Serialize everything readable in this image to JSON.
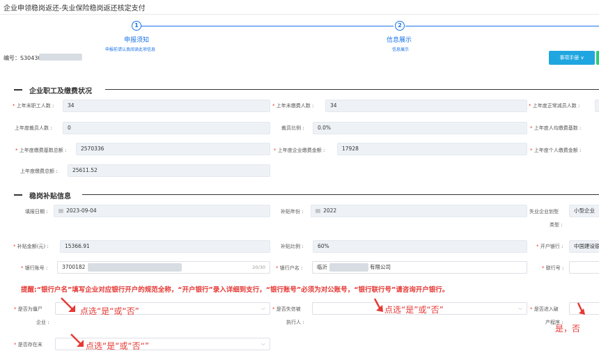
{
  "page": {
    "title": "企业申领稳岗返还-失业保险稳岗返还核定支付"
  },
  "steps": [
    {
      "num": "1",
      "title": "申报须知",
      "sub": "申报前请认真阅读此项信息"
    },
    {
      "num": "2",
      "title": "信息展示",
      "sub": "信息展示"
    }
  ],
  "header": {
    "serial_label": "编号：S3043090",
    "manual_button": "事项手册 ∨"
  },
  "section1": {
    "title": "企业职工及缴费状况",
    "fields": {
      "last_year_end_staff": {
        "label": "上年末职工人数",
        "value": "34"
      },
      "last_year_end_paid": {
        "label": "上年末缴费人数",
        "value": "34"
      },
      "last_year_reduced": {
        "label": "上年度正常减员人数"
      },
      "last_year_laid_off": {
        "label": "上年度裁员人数",
        "value": "0"
      },
      "layoff_ratio": {
        "label": "裁员比例",
        "value": "0.0%"
      },
      "avg_base": {
        "label": "上年度人均缴费基数"
      },
      "total_base": {
        "label": "上年度缴费基数总额",
        "value": "2570336"
      },
      "enterprise_amount": {
        "label": "上年度企业缴费金额",
        "value": "17928"
      },
      "personal_amount": {
        "label": "上年度个人缴费金额"
      },
      "total_paid": {
        "label": "上年度缴费总额",
        "value": "25611.52"
      }
    }
  },
  "section2": {
    "title": "稳岗补贴信息",
    "fields": {
      "fill_date": {
        "label": "填报日期",
        "value": "2023-09-04"
      },
      "subsidy_year": {
        "label": "补贴年份",
        "value": "2022"
      },
      "enterprise_type": {
        "label": "失业企业划型",
        "label2": "类型",
        "value": "小型企业"
      },
      "subsidy_amount": {
        "label": "补贴金额(元)",
        "value": "15366.91"
      },
      "subsidy_ratio": {
        "label": "补贴比例",
        "value": "60%"
      },
      "bank": {
        "label": "开户银行",
        "value": "中国建设银"
      },
      "account_no": {
        "label": "银行账号",
        "value": "3700182",
        "counter": "20/30"
      },
      "account_name": {
        "label": "银行户名",
        "value_prefix": "临沂",
        "value_suffix": "有限公司"
      },
      "bank_link_no": {
        "label": "联行号"
      },
      "zombie": {
        "label": "是否为僵尸",
        "label2": "企业"
      },
      "dishonest": {
        "label": "是否失信被",
        "label2": "执行人"
      },
      "bankruptcy": {
        "label": "是否进入破",
        "label2": "产程序"
      },
      "exists": {
        "label": "是否存在末"
      }
    }
  },
  "annotations": {
    "notice": "提醒:“银行户名”填写企业对应银行开户的规范全称，“开户银行”录入详细到支行，“银行账号”必须为对公账号，“银行联行号”请咨询开户银行。",
    "hint1": "点选“是“或“否”",
    "hint2": "点选“是”或“否”",
    "hint3": "是，否",
    "hint4": "点选“是“或“否“”"
  },
  "colors": {
    "accent": "#1a73e8",
    "annotation": "#e53935",
    "field_bg": "#eef2f6"
  }
}
